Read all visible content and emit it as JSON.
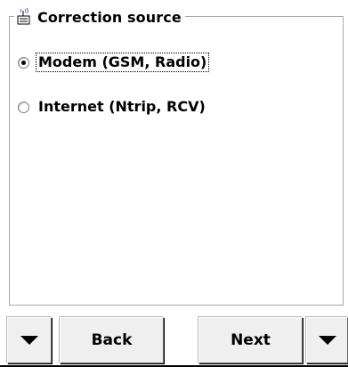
{
  "group": {
    "title": "Correction source",
    "icon": "radio-antenna-icon"
  },
  "options": [
    {
      "label": "Modem (GSM, Radio)",
      "selected": true,
      "focused": true
    },
    {
      "label": "Internet (Ntrip, RCV)",
      "selected": false,
      "focused": false
    }
  ],
  "buttons": {
    "back_label": "Back",
    "next_label": "Next",
    "left_arrow_icon": "triangle-down-icon",
    "right_arrow_icon": "triangle-down-icon"
  }
}
